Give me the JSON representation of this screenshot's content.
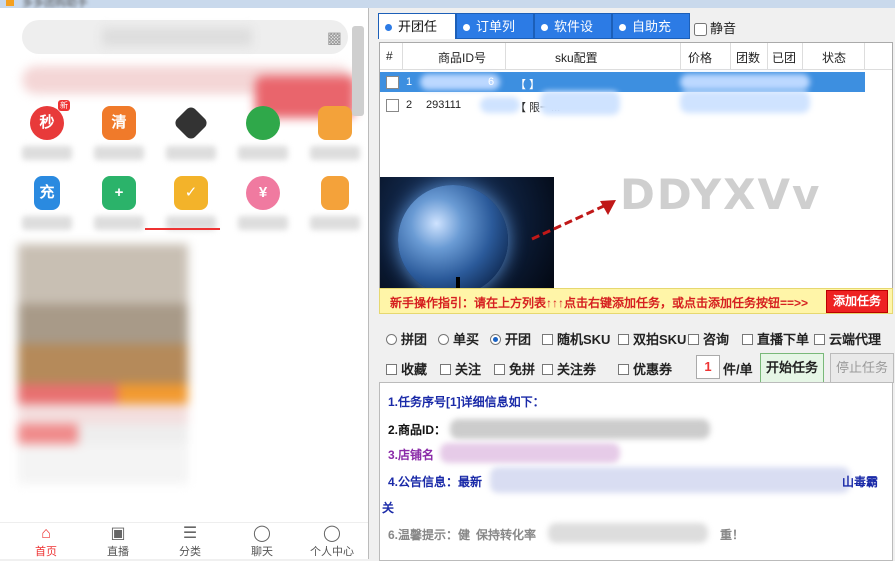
{
  "window": {
    "title": "多多团购助手"
  },
  "left_app": {
    "search_icon": "camera-icon",
    "grid": [
      {
        "label": "秒",
        "badge": "新",
        "color": "#e83a3a",
        "icon": "alarm-clock-icon"
      },
      {
        "label": "清",
        "color": "#f07a2a",
        "icon": "truck-icon"
      },
      {
        "label": "",
        "color": "#333333",
        "icon": "diamond-icon"
      },
      {
        "label": "",
        "color": "#2fa84a",
        "icon": "leaf-icon"
      },
      {
        "label": "",
        "color": "#f3a23a",
        "icon": "gift-icon"
      },
      {
        "label": "充",
        "color": "#2a8ae0",
        "icon": "phone-charge-icon"
      },
      {
        "label": "",
        "color": "#2bb36a",
        "icon": "medical-box-icon"
      },
      {
        "label": "",
        "color": "#f3b32a",
        "icon": "calendar-icon"
      },
      {
        "label": "",
        "color": "#f07aa0",
        "icon": "piggy-bank-icon"
      },
      {
        "label": "",
        "color": "#f4a23a",
        "icon": "document-like-icon"
      }
    ],
    "nav": [
      {
        "label": "首页",
        "icon": "home-icon",
        "active": true
      },
      {
        "label": "直播",
        "icon": "tv-icon"
      },
      {
        "label": "分类",
        "icon": "list-icon"
      },
      {
        "label": "聊天",
        "icon": "chat-icon"
      },
      {
        "label": "个人中心",
        "icon": "person-icon"
      }
    ]
  },
  "tabs": [
    {
      "label": "开团任务",
      "active": true
    },
    {
      "label": "订单列表"
    },
    {
      "label": "软件设置"
    },
    {
      "label": "自助充值"
    }
  ],
  "mute_label": "静音",
  "table": {
    "columns": [
      "#",
      "商品ID号",
      "sku配置",
      "价格",
      "团数",
      "已团",
      "状态"
    ],
    "rows": [
      {
        "num": "1",
        "pid": "6",
        "sku": "【 】",
        "selected": true
      },
      {
        "num": "2",
        "pid": "293111",
        "sku": "【         限一...",
        "selected": false
      }
    ]
  },
  "watermark": "DDYXVv",
  "guide": {
    "text": "新手操作指引：请在上方列表↑↑↑点击右键添加任务，或点击添加任务按钮==>>",
    "button": "添加任务"
  },
  "options_row1": [
    {
      "type": "radio",
      "label": "拼团",
      "checked": false
    },
    {
      "type": "radio",
      "label": "单买",
      "checked": false
    },
    {
      "type": "radio",
      "label": "开团",
      "checked": true
    },
    {
      "type": "check",
      "label": "随机SKU"
    },
    {
      "type": "check",
      "label": "双拍SKU"
    },
    {
      "type": "check",
      "label": "咨询"
    },
    {
      "type": "check",
      "label": "直播下单"
    },
    {
      "type": "check",
      "label": "云端代理"
    }
  ],
  "options_row2": [
    {
      "type": "check",
      "label": "收藏"
    },
    {
      "type": "check",
      "label": "关注"
    },
    {
      "type": "check",
      "label": "免拼"
    },
    {
      "type": "check",
      "label": "关注券"
    },
    {
      "type": "check",
      "label": "优惠券"
    }
  ],
  "quantity": "1",
  "unit_label": "件/单",
  "start_button": "开始任务",
  "stop_button": "停止任务",
  "info": {
    "line1": "1.任务序号[1]详细信息如下：",
    "line2": "2.商品ID：",
    "line3": "3.店铺名",
    "line4": "4.公告信息：最新",
    "line4_end": "山毒霸",
    "line5": "关",
    "line6": "6.温馨提示：健",
    "line6_mid": "保持转化率",
    "line6_end": "重！"
  }
}
